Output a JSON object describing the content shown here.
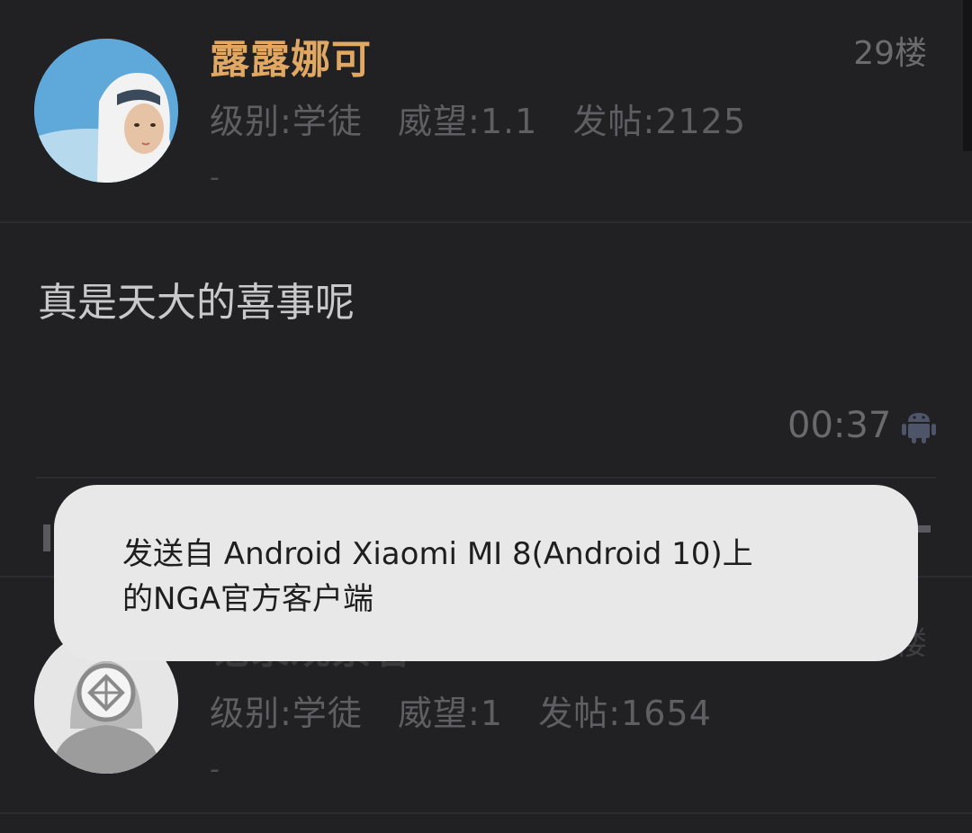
{
  "post1": {
    "username": "露露娜可",
    "floor": "29楼",
    "meta": "级别:学徒   威望:1.1   发帖:2125",
    "dash": "-",
    "content": "真是天大的喜事呢",
    "time": "00:37",
    "device_icon": "android-icon"
  },
  "actions": {
    "icons": [
      "thumbs-up-icon",
      "thumbs-down-icon",
      "comment-icon",
      "plus-icon"
    ]
  },
  "toast": {
    "line1": "发送自 Android Xiaomi MI 8(Android 10)上",
    "line2": "的NGA官方客户端"
  },
  "post2": {
    "username": "记录观察者",
    "floor": "30楼",
    "meta": "级别:学徒   威望:1   发帖:1654",
    "dash": "-"
  },
  "colors": {
    "background": "#212124",
    "username": "#e0a862",
    "toast_bg": "#e8e8e8"
  }
}
